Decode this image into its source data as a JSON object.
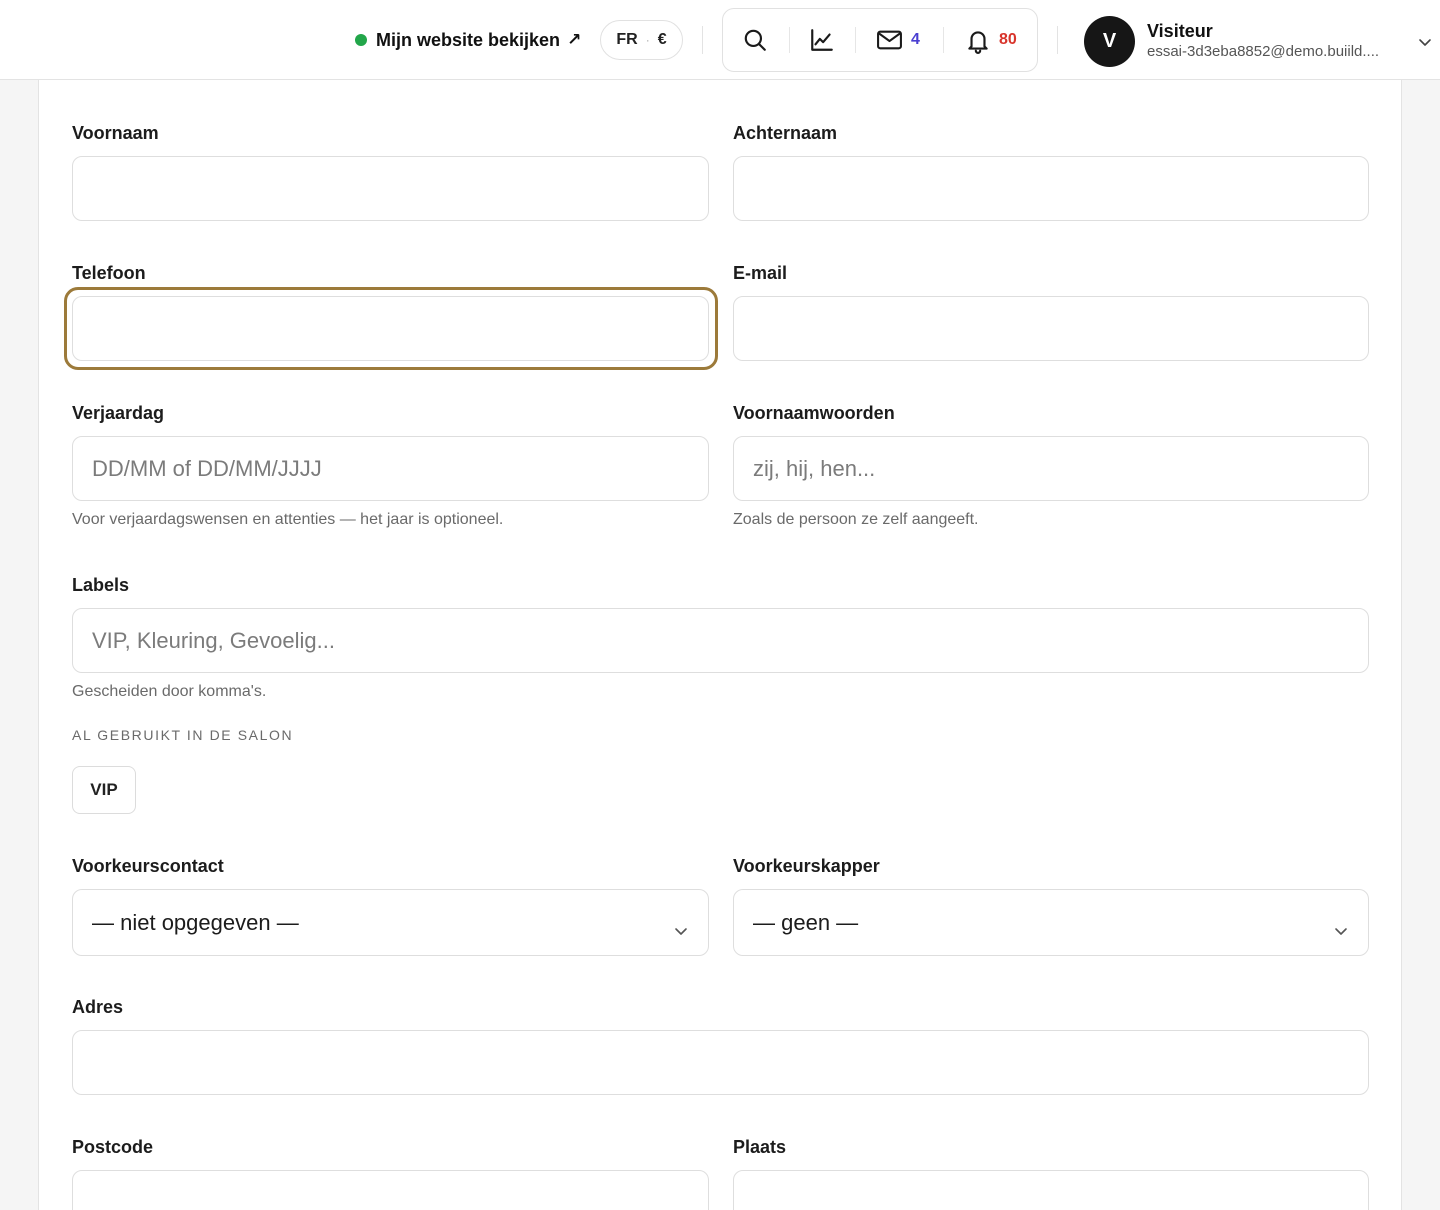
{
  "header": {
    "site_link": "Mijn website bekijken",
    "site_link_arrow": "↗",
    "status_color": "#22a64a",
    "locale": {
      "lang": "FR",
      "separator": "·",
      "currency": "€"
    },
    "tools": {
      "search_icon": "search-icon",
      "stats_icon": "chart-line-icon",
      "mail_icon": "mail-icon",
      "mail_count": "4",
      "bell_icon": "bell-icon",
      "bell_count": "80"
    },
    "user": {
      "initial": "V",
      "name": "Visiteur",
      "email": "essai-3d3eba8852@demo.buiild...."
    }
  },
  "form": {
    "first_name": {
      "label": "Voornaam",
      "value": "",
      "placeholder": ""
    },
    "last_name": {
      "label": "Achternaam",
      "value": "",
      "placeholder": ""
    },
    "phone": {
      "label": "Telefoon",
      "value": "",
      "placeholder": ""
    },
    "email": {
      "label": "E-mail",
      "value": "",
      "placeholder": ""
    },
    "birthday": {
      "label": "Verjaardag",
      "placeholder": "DD/MM of DD/MM/JJJJ",
      "hint": "Voor verjaardagswensen en attenties — het jaar is optioneel."
    },
    "pronouns": {
      "label": "Voornaamwoorden",
      "placeholder": "zij, hij, hen...",
      "hint": "Zoals de persoon ze zelf aangeeft."
    },
    "labels": {
      "label": "Labels",
      "placeholder": "VIP, Kleuring, Gevoelig...",
      "hint": "Gescheiden door komma's.",
      "used_title": "AL GEBRUIKT IN DE SALON",
      "used_chips": [
        "VIP"
      ]
    },
    "preferred_contact": {
      "label": "Voorkeurscontact",
      "selected": "— niet opgegeven —"
    },
    "preferred_stylist": {
      "label": "Voorkeurskapper",
      "selected": "— geen —"
    },
    "address": {
      "label": "Adres",
      "value": ""
    },
    "postcode": {
      "label": "Postcode",
      "value": ""
    },
    "city": {
      "label": "Plaats",
      "value": ""
    },
    "focus_color": "#9c7a3a"
  }
}
